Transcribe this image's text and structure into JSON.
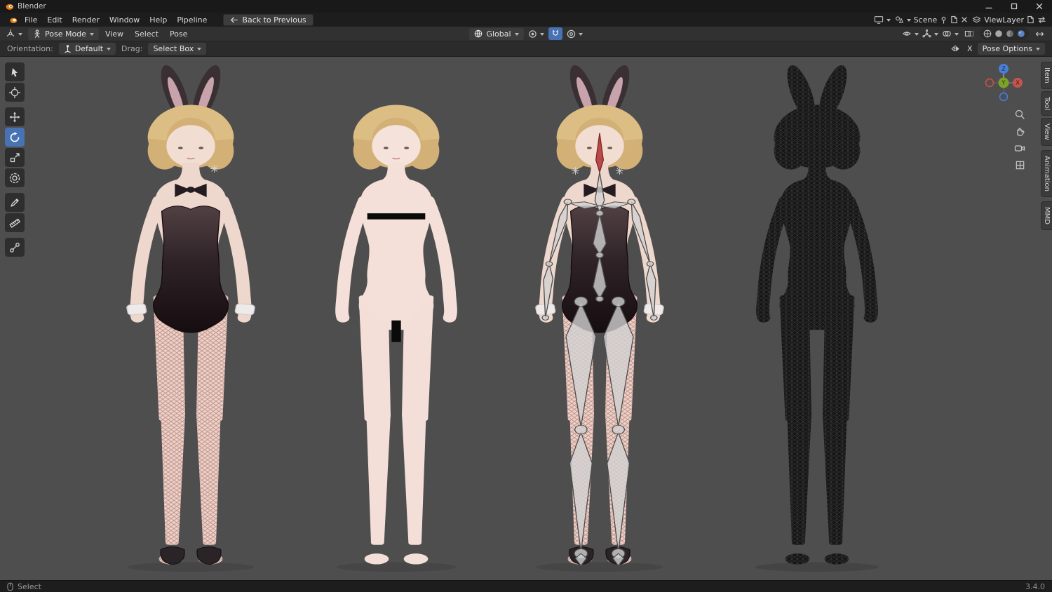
{
  "app": {
    "titlebar_title": "Blender"
  },
  "colors": {
    "accent": "#4772b3",
    "viewport_background": "#4e4e4e",
    "axis_x": "#c4554d",
    "axis_y": "#7ca328",
    "axis_z": "#4a7fd6",
    "suit": "#2c2125",
    "skin": "#eed7cc",
    "hair": "#d3b176"
  },
  "menubar": {
    "menus": [
      "File",
      "Edit",
      "Render",
      "Window",
      "Help",
      "Pipeline"
    ],
    "back_button": "Back to Previous",
    "scene_field": "Scene",
    "viewlayer_field": "ViewLayer"
  },
  "header": {
    "mode_select": "Pose Mode",
    "menus": [
      "View",
      "Select",
      "Pose"
    ],
    "orientation_select": "Global"
  },
  "tool_settings": {
    "orientation_label": "Orientation:",
    "orientation_value": "Default",
    "drag_label": "Drag:",
    "drag_value": "Select Box",
    "mirror_x_label": "X",
    "pose_options_label": "Pose Options"
  },
  "toolbar": {
    "tools": [
      "tweak-select",
      "cursor",
      "move",
      "rotate",
      "scale",
      "transform",
      "annotate",
      "measure",
      "pose-breakdowner"
    ],
    "active_tool": "rotate"
  },
  "gizmo_axes": {
    "x": "X",
    "y": "Y",
    "z": "Z"
  },
  "side_tabs": [
    "Item",
    "Tool",
    "View",
    "Animation",
    "MMD"
  ],
  "statusbar": {
    "action_hint": "Select",
    "version": "3.4.0"
  }
}
